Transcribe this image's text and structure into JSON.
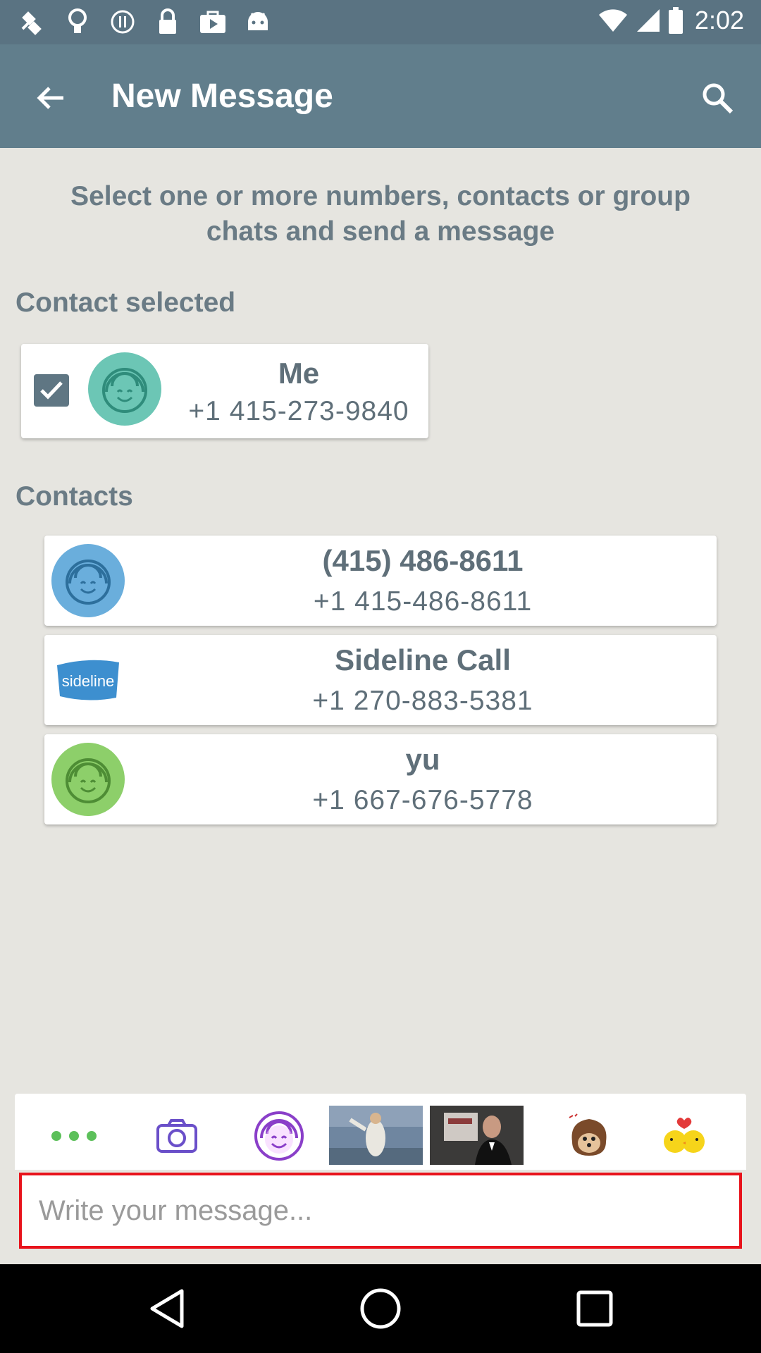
{
  "status_bar": {
    "time": "2:02",
    "icons": [
      "fax-satellite-icon",
      "bulb-icon",
      "info-icon",
      "lock-icon",
      "play-store-icon",
      "android-icon"
    ]
  },
  "app_bar": {
    "title": "New Message"
  },
  "instruction": "Select one or more numbers, contacts or group chats and send a message",
  "selected_section": {
    "label": "Contact selected",
    "contact": {
      "name": "Me",
      "number": "+1 415-273-9840",
      "avatar_color": "#6cc6b5"
    }
  },
  "contacts_section": {
    "label": "Contacts",
    "contacts": [
      {
        "name": "(415) 486-8611",
        "number": "+1 415-486-8611",
        "avatar_color": "#6aaedc"
      },
      {
        "name": "Sideline Call",
        "number": "+1 270-883-5381",
        "avatar_color": "#3d8fcf",
        "logo_text": "sideline"
      },
      {
        "name": "yu",
        "number": "+1 667-676-5778",
        "avatar_color": "#8dcf6a"
      }
    ]
  },
  "attachments": {
    "items": [
      "more-icon",
      "camera-icon",
      "smiley-sticker-icon",
      "gif-thumbnail-1",
      "gif-thumbnail-2",
      "hedgehog-sticker",
      "kissing-chicks-sticker"
    ],
    "accent": "#6a4fc9"
  },
  "composer": {
    "placeholder": "Write your message..."
  },
  "colors": {
    "app_bar": "#617e8c",
    "status_bar": "#5a7382",
    "background": "#e6e5e0",
    "input_border": "#e8131c"
  }
}
